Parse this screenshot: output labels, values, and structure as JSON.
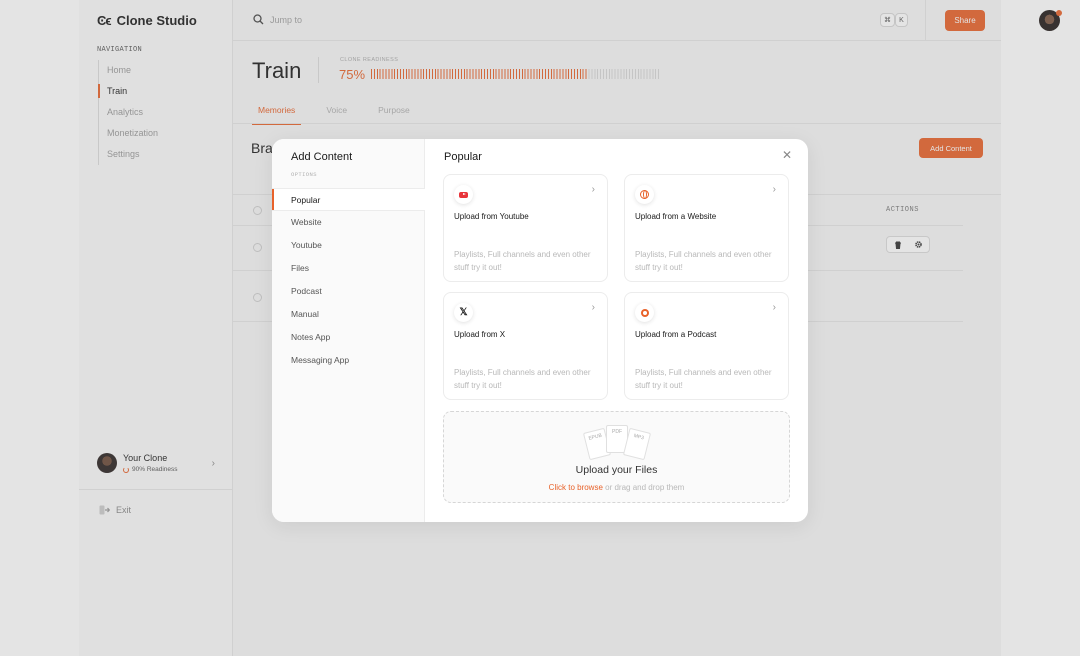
{
  "brand": {
    "name": "Clone Studio",
    "logo_glyph": "Ͼϵ"
  },
  "nav": {
    "heading": "NAVIGATION",
    "items": [
      "Home",
      "Train",
      "Analytics",
      "Monetization",
      "Settings"
    ],
    "active": "Train"
  },
  "clone": {
    "name": "Your Clone",
    "readiness": "90% Readiness"
  },
  "exit_label": "Exit",
  "topbar": {
    "search_placeholder": "Jump to",
    "kbd_1": "⌘",
    "kbd_2": "K",
    "share_label": "Share"
  },
  "page": {
    "title": "Train",
    "readiness_label": "CLONE READINESS",
    "readiness_value": "75%",
    "readiness_fraction": 0.75,
    "tabs": [
      "Memories",
      "Voice",
      "Purpose"
    ],
    "active_tab": "Memories",
    "section_title": "Bra",
    "add_content_label": "Add Content",
    "actions_header": "ACTIONS"
  },
  "modal": {
    "title": "Add Content",
    "options_label": "OPTIONS",
    "options": [
      "Popular",
      "Website",
      "Youtube",
      "Files",
      "Podcast",
      "Manual",
      "Notes App",
      "Messaging App"
    ],
    "active_option": "Popular",
    "heading": "Popular",
    "close_glyph": "✕",
    "cards": [
      {
        "icon": "youtube-icon",
        "title": "Upload from Youtube",
        "desc": "Playlists, Full channels and even other stuff try it out!"
      },
      {
        "icon": "globe-icon",
        "title": "Upload from a Website",
        "desc": "Playlists, Full channels and even other stuff try it out!"
      },
      {
        "icon": "x-icon",
        "title": "Upload from X",
        "desc": "Playlists, Full channels and even other stuff try it out!"
      },
      {
        "icon": "podcast-icon",
        "title": "Upload from a Podcast",
        "desc": "Playlists, Full channels and even other stuff try it out!"
      }
    ],
    "dropzone": {
      "file_types": [
        "EPUB",
        "PDF",
        "MP3"
      ],
      "title": "Upload your Files",
      "link": "Click to browse",
      "rest": " or drag and drop them"
    }
  },
  "colors": {
    "accent": "#e8622a"
  }
}
